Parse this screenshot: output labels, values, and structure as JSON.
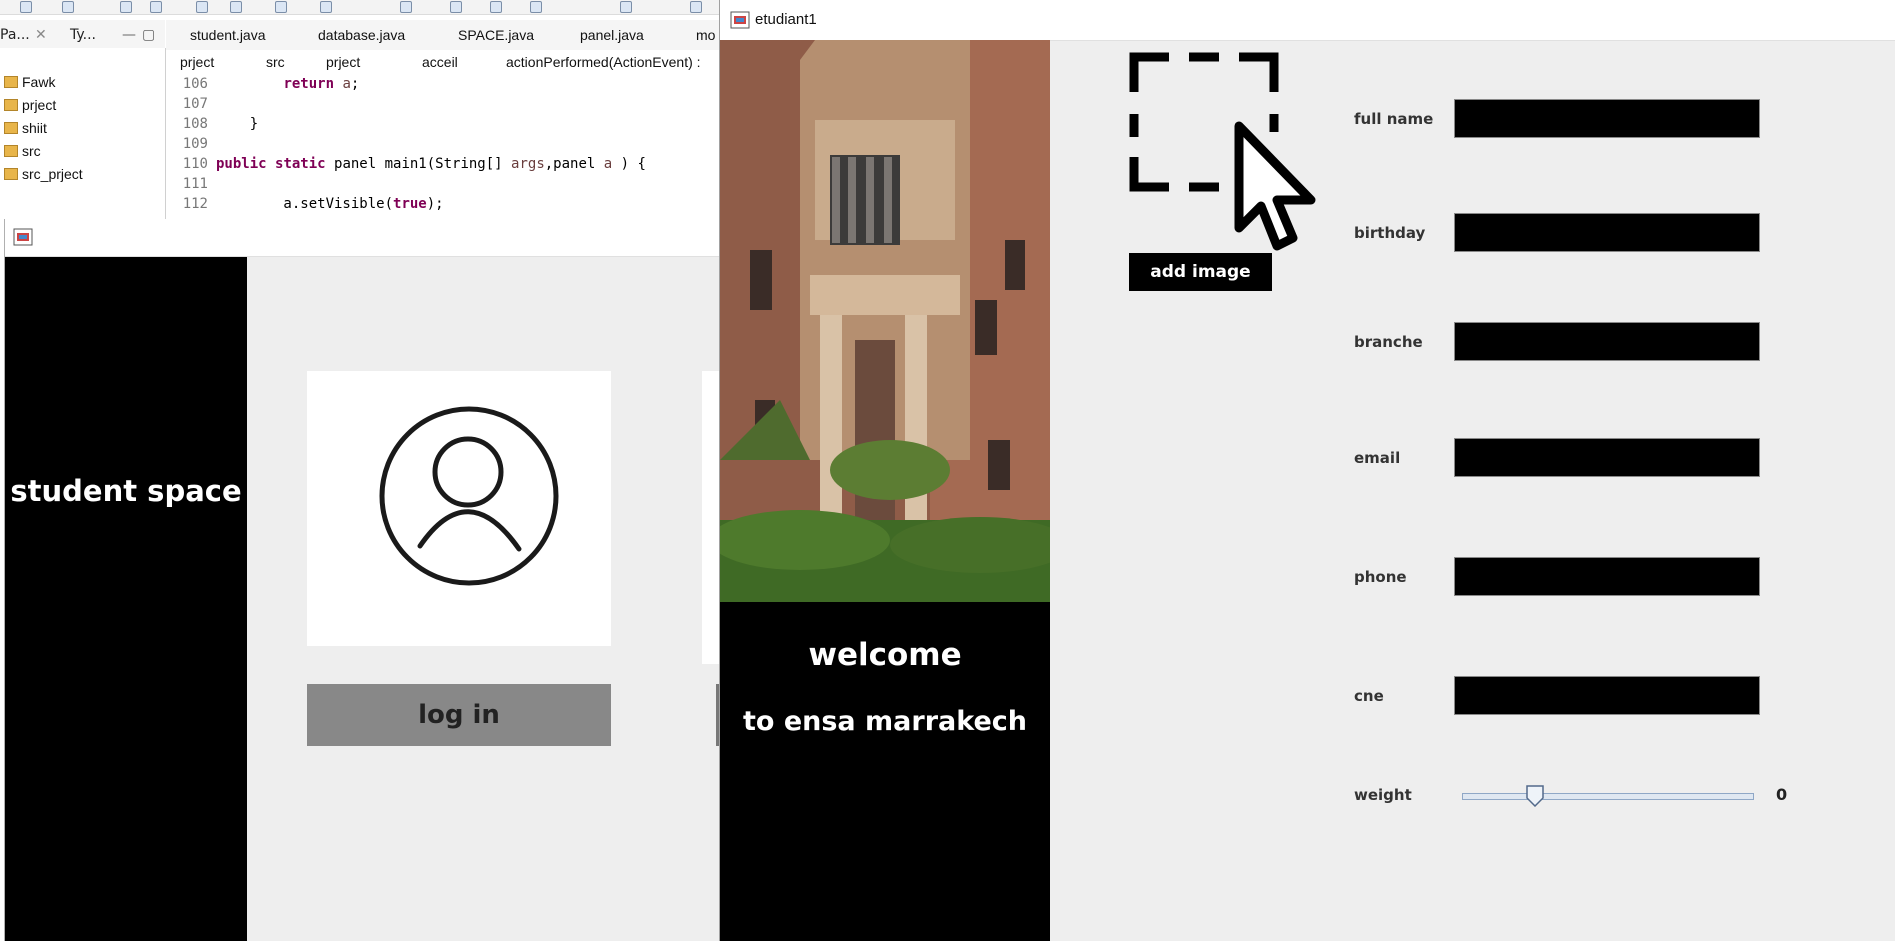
{
  "ide": {
    "view_tabs": [
      "Pa...",
      "Ty..."
    ],
    "explorer_items": [
      "Fawk",
      "prject",
      "shiit",
      "src",
      "src_prject"
    ],
    "editor_tabs": [
      "student.java",
      "database.java",
      "SPACE.java",
      "panel.java",
      "mo"
    ],
    "breadcrumb": [
      "prject",
      "src",
      "prject",
      "acceil",
      "actionPerformed(ActionEvent) :"
    ],
    "code": [
      {
        "n": "106",
        "text": "        return a;"
      },
      {
        "n": "107",
        "text": ""
      },
      {
        "n": "108",
        "text": "    }"
      },
      {
        "n": "109",
        "text": ""
      },
      {
        "n": "110",
        "text": "public static panel main1(String[] args,panel a ) {"
      },
      {
        "n": "111",
        "text": ""
      },
      {
        "n": "112",
        "text": "        a.setVisible(true);"
      }
    ]
  },
  "login_window": {
    "sidebar_title": "student space",
    "login_label": "log in"
  },
  "etudiant_window": {
    "title": "etudiant1",
    "welcome_line1": "welcome",
    "welcome_line2": "to ensa marrakech",
    "add_image_label": "add image",
    "fields": {
      "full_name": {
        "label": "full name",
        "value": ""
      },
      "birthday": {
        "label": "birthday",
        "value": ""
      },
      "branche": {
        "label": "branche",
        "value": ""
      },
      "email": {
        "label": "email",
        "value": ""
      },
      "phone": {
        "label": "phone",
        "value": ""
      },
      "cne": {
        "label": "cne",
        "value": ""
      }
    },
    "weight": {
      "label": "weight",
      "value_text": "0",
      "slider_fraction": 0.25
    }
  },
  "colors": {
    "panel_black": "#000000",
    "button_gray": "#888888",
    "window_bg": "#eeeeee"
  }
}
